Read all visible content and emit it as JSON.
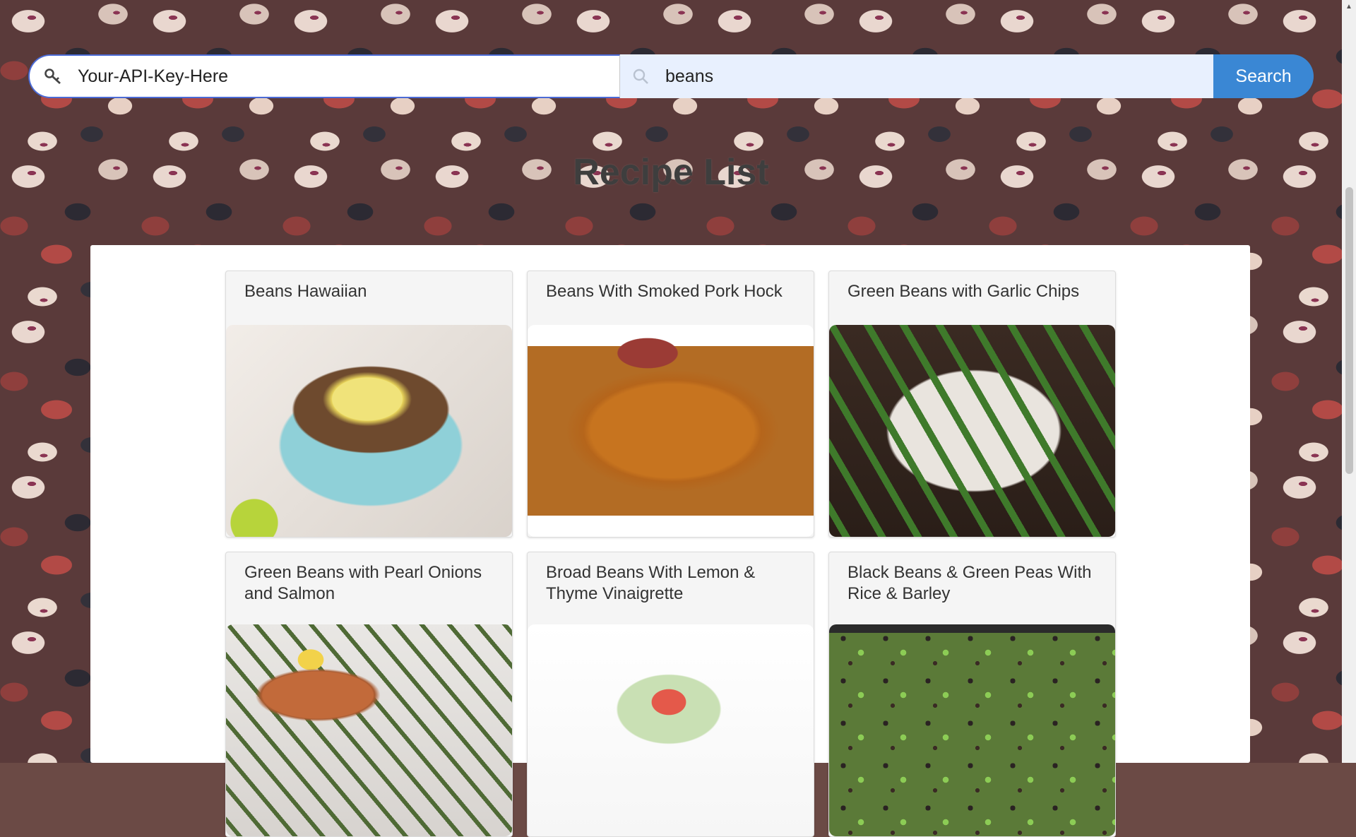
{
  "search": {
    "api_key_value": "Your-API-Key-Here",
    "query_value": "beans",
    "button_label": "Search"
  },
  "page": {
    "title": "Recipe List"
  },
  "recipes": [
    {
      "title": "Beans Hawaiian"
    },
    {
      "title": "Beans With Smoked Pork Hock"
    },
    {
      "title": "Green Beans with Garlic Chips"
    },
    {
      "title": "Green Beans with Pearl Onions and Salmon"
    },
    {
      "title": "Broad Beans With Lemon & Thyme Vinaigrette"
    },
    {
      "title": "Black Beans & Green Peas With Rice & Barley"
    }
  ],
  "icons": {
    "api_key": "key-icon",
    "query": "search-icon"
  },
  "colors": {
    "search_button": "#3a87d4",
    "focus_border": "#4b6bd6",
    "query_bg": "#e8f0fe"
  }
}
